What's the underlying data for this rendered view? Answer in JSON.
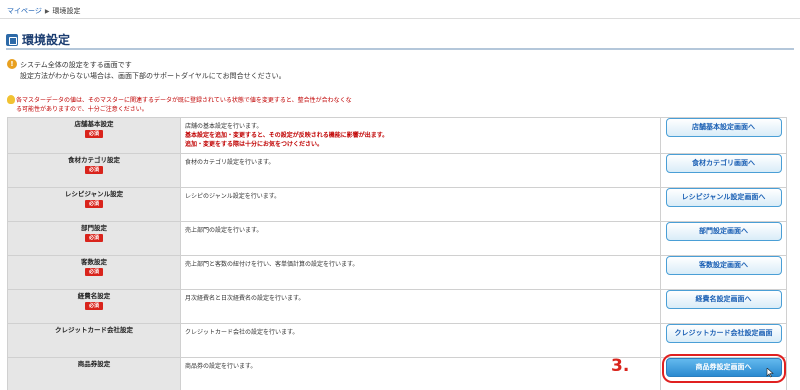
{
  "breadcrumb": {
    "home": "マイページ",
    "separator": "▶",
    "current": "環境設定"
  },
  "page": {
    "title": "環境設定"
  },
  "info": {
    "line1": "システム全体の設定をする画面です",
    "line2": "設定方法がわからない場合は、画面下部のサポートダイヤルにてお問合せください。"
  },
  "warning": {
    "line1": "各マスターデータの値は、そのマスターに関連するデータが既に登録されている状態で値を変更すると、整合性が合わなくな",
    "line2": "る可能性がありますので、十分ご注意ください。"
  },
  "required_badge": "必須",
  "rows": [
    {
      "name": "店舗基本設定",
      "required": true,
      "desc": "店舗の基本設定を行います。",
      "desc_red1": "基本設定を追加・変更すると、その設定が反映される機能に影響が出ます。",
      "desc_red2": "追加・変更をする際は十分にお気をつけください。",
      "button": "店舗基本設定画面へ"
    },
    {
      "name": "食材カテゴリ設定",
      "required": true,
      "desc": "食材のカテゴリ設定を行います。",
      "button": "食材カテゴリ画面へ"
    },
    {
      "name": "レシピジャンル設定",
      "required": true,
      "desc": "レシピのジャンル設定を行います。",
      "button": "レシピジャンル設定画面へ"
    },
    {
      "name": "部門設定",
      "required": true,
      "desc": "売上部門の設定を行います。",
      "button": "部門設定画面へ"
    },
    {
      "name": "客数設定",
      "required": true,
      "desc": "売上部門と客数の紐付けを行い、客単価計算の設定を行います。",
      "button": "客数設定画面へ"
    },
    {
      "name": "経費名設定",
      "required": true,
      "desc": "月次経費名と日次経費名の設定を行います。",
      "button": "経費名設定画面へ"
    },
    {
      "name": "クレジットカード会社設定",
      "required": false,
      "desc": "クレジットカード会社の設定を行います。",
      "button": "クレジットカード会社設定画面"
    },
    {
      "name": "商品券設定",
      "required": false,
      "desc": "商品券の設定を行います。",
      "button": "商品券設定画面へ"
    }
  ],
  "annotation": {
    "step": "3."
  },
  "colors": {
    "accent": "#2b8ad0",
    "required": "#d9241c",
    "warning": "#c00000",
    "title": "#1a3c70"
  }
}
